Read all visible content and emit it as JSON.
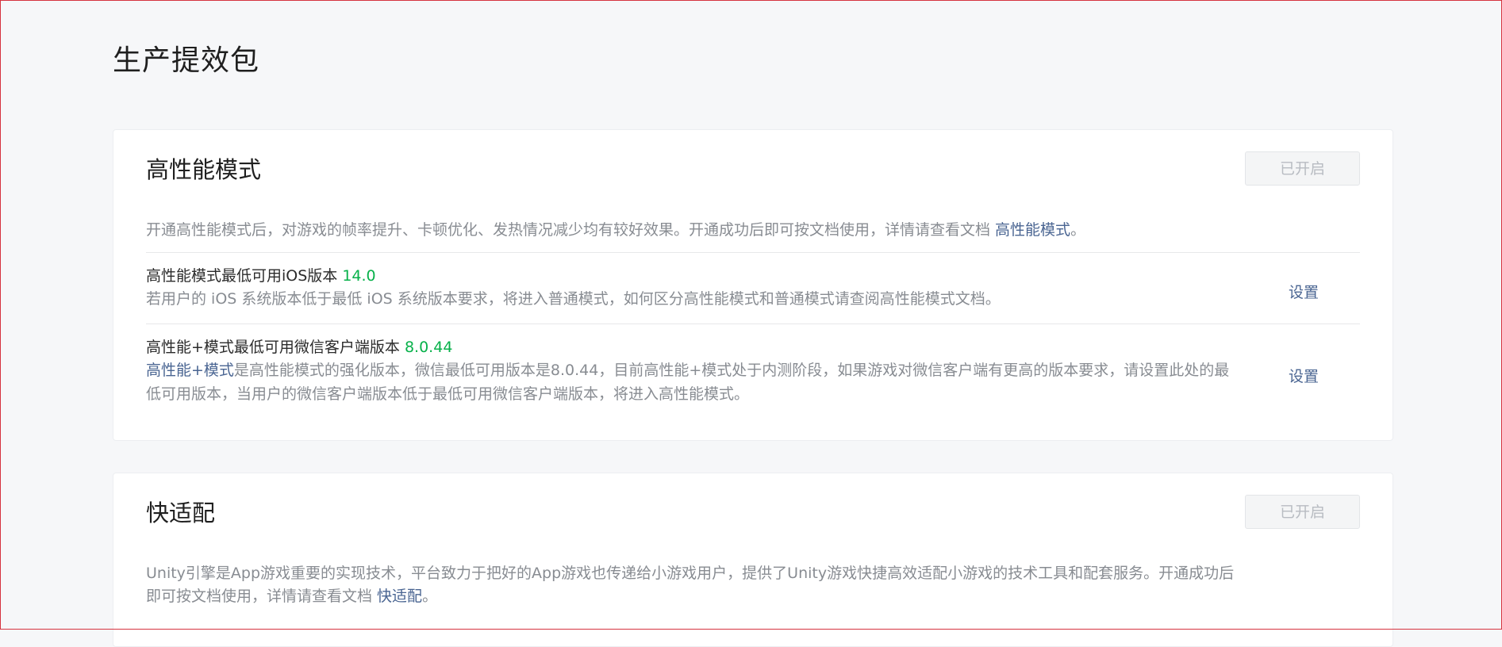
{
  "page": {
    "title": "生产提效包"
  },
  "high_perf": {
    "title": "高性能模式",
    "status_button": "已开启",
    "desc_text": "开通高性能模式后，对游戏的帧率提升、卡顿优化、发热情况减少均有较好效果。开通成功后即可按文档使用，详情请查看文档 ",
    "desc_link": "高性能模式",
    "desc_end": "。",
    "rows": [
      {
        "title": "高性能模式最低可用iOS版本 ",
        "version": "14.0",
        "desc_link": "",
        "desc": "若用户的 iOS 系统版本低于最低 iOS 系统版本要求，将进入普通模式，如何区分高性能模式和普通模式请查阅高性能模式文档。",
        "action": "设置"
      },
      {
        "title": "高性能+模式最低可用微信客户端版本 ",
        "version": "8.0.44",
        "desc_link": "高性能+模式",
        "desc": "是高性能模式的强化版本，微信最低可用版本是8.0.44，目前高性能+模式处于内测阶段，如果游戏对微信客户端有更高的版本要求，请设置此处的最低可用版本，当用户的微信客户端版本低于最低可用微信客户端版本，将进入高性能模式。",
        "action": "设置"
      }
    ]
  },
  "quick_adapt": {
    "title": "快适配",
    "status_button": "已开启",
    "desc_text": "Unity引擎是App游戏重要的实现技术，平台致力于把好的App游戏也传递给小游戏用户，提供了Unity游戏快捷高效适配小游戏的技术工具和配套服务。开通成功后即可按文档使用，详情请查看文档 ",
    "desc_link": "快适配",
    "desc_end": "。"
  },
  "colors": {
    "link": "#4a6592",
    "version_green": "#07b14a",
    "muted_text": "#888c92",
    "border_red": "#d6333f"
  }
}
